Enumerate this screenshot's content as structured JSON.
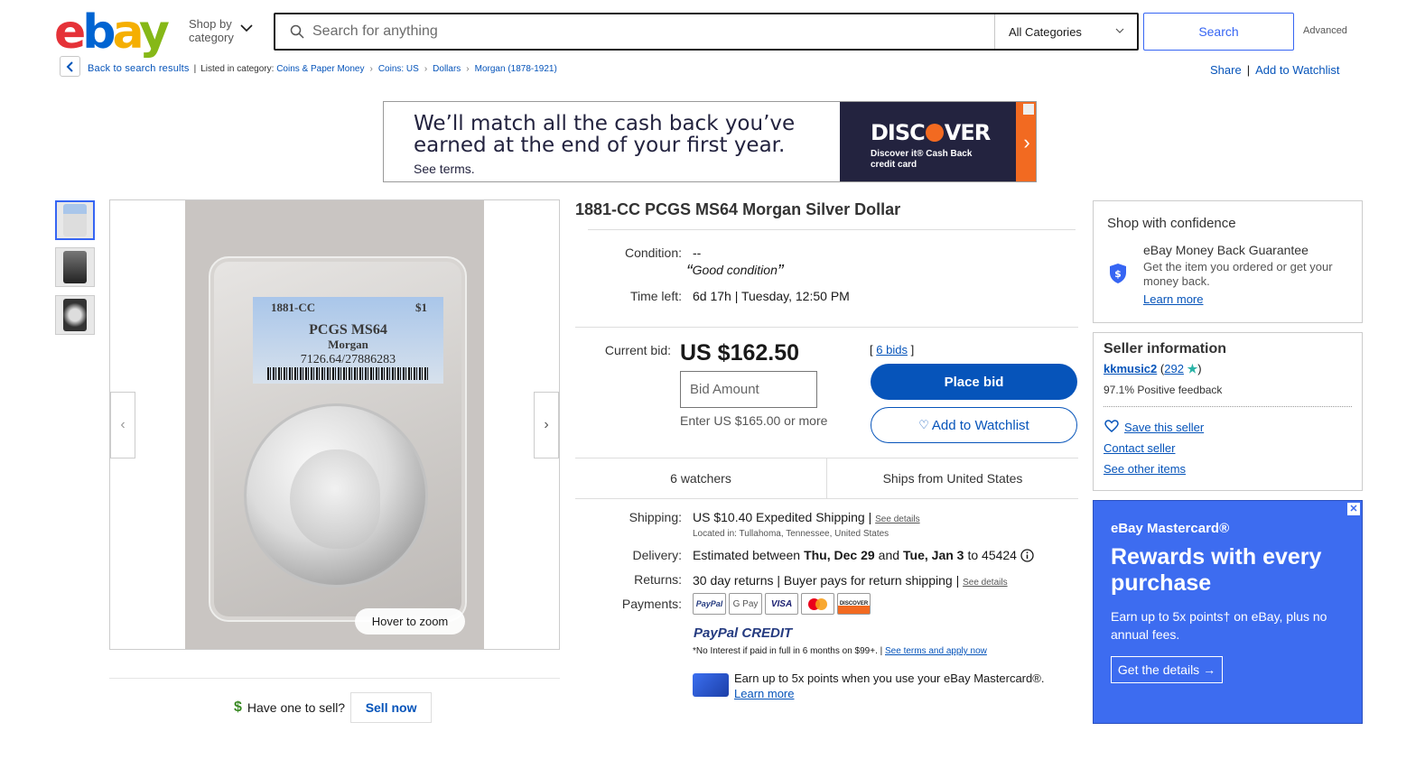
{
  "header": {
    "logo": {
      "e": "e",
      "b": "b",
      "a": "a",
      "y": "y"
    },
    "shop_by_line1": "Shop by",
    "shop_by_line2": "category",
    "search_placeholder": "Search for anything",
    "category_select": "All Categories",
    "search_button": "Search",
    "advanced": "Advanced"
  },
  "breadcrumb": {
    "back": "Back to search results",
    "listed_in": "Listed in category:",
    "items": [
      "Coins & Paper Money",
      "Coins: US",
      "Dollars",
      "Morgan (1878-1921)"
    ],
    "share": "Share",
    "add_to_watchlist": "Add to Watchlist"
  },
  "banner_ad": {
    "headline_line1": "We’ll match all the cash back you’ve",
    "headline_line2": "earned at the end of your first year.",
    "terms": "See terms.",
    "brand_part1": "DISC",
    "brand_part2": "VER",
    "subtitle": "Discover it® Cash Back credit card"
  },
  "gallery": {
    "zoom_hint": "Hover to zoom",
    "prev_arrow": "‹",
    "next_arrow": "›",
    "slab_label": {
      "line1_left": "1881-CC",
      "line1_right": "$1",
      "grade": "PCGS MS64",
      "type": "Morgan",
      "cert": "7126.64/27886283"
    }
  },
  "sell": {
    "prompt": "Have one to sell?",
    "button": "Sell now",
    "dollar": "$"
  },
  "item": {
    "title": "1881-CC PCGS MS64 Morgan Silver Dollar",
    "condition_label": "Condition:",
    "condition_value": "--",
    "condition_note": "Good condition",
    "time_left_label": "Time left:",
    "time_left_value": "6d 17h | Tuesday, 12:50 PM",
    "current_bid_label": "Current bid:",
    "current_bid": "US $162.50",
    "bids_open": "[",
    "bids_link": "6 bids",
    "bids_close": "]",
    "bid_placeholder": "Bid Amount",
    "bid_hint": "Enter US $165.00 or more",
    "place_bid": "Place bid",
    "add_to_watchlist": "Add to Watchlist",
    "watchers": "6 watchers",
    "ships_from": "Ships from United States"
  },
  "details": {
    "shipping_label": "Shipping:",
    "shipping_value": "US $10.40 Expedited Shipping |",
    "shipping_link": "See details",
    "location": "Located in: Tullahoma, Tennessee, United States",
    "delivery_label": "Delivery:",
    "delivery_pre": "Estimated between",
    "delivery_d1": "Thu, Dec 29",
    "delivery_and": "and",
    "delivery_d2": "Tue, Jan 3",
    "delivery_post": "to 45424",
    "returns_label": "Returns:",
    "returns_value": "30 day returns | Buyer pays for return shipping |",
    "returns_link": "See details",
    "payments_label": "Payments:",
    "payment_icons": [
      "PayPal",
      "G Pay",
      "VISA",
      "Mastercard",
      "DISCOVER"
    ],
    "paypal_credit_1": "PayPal",
    "paypal_credit_2": "CREDIT",
    "paypal_note": "*No Interest if paid in full in 6 months on $99+. |",
    "paypal_link": "See terms and apply now",
    "mastercard_text": "Earn up to 5x points when you use your eBay Mastercard®.",
    "mastercard_link": "Learn more"
  },
  "confidence": {
    "title": "Shop with confidence",
    "guarantee_title": "eBay Money Back Guarantee",
    "guarantee_text": "Get the item you ordered or get your money back.",
    "learn_more": "Learn more"
  },
  "seller": {
    "title": "Seller information",
    "name": "kkmusic2",
    "open": "(",
    "score": "292",
    "close": ")",
    "feedback": "97.1% Positive feedback",
    "save": "Save this seller",
    "contact": "Contact seller",
    "other": "See other items"
  },
  "mastercard_ad": {
    "brand": "eBay Mastercard®",
    "headline": "Rewards with every purchase",
    "body": "Earn up to 5x points† on eBay, plus no annual fees.",
    "cta": "Get the details →",
    "close": "✕"
  },
  "colors": {
    "link": "#0654ba",
    "primary_button": "#0654ba",
    "search_button_border": "#3665f3",
    "ad_blue": "#3d6cf0"
  }
}
